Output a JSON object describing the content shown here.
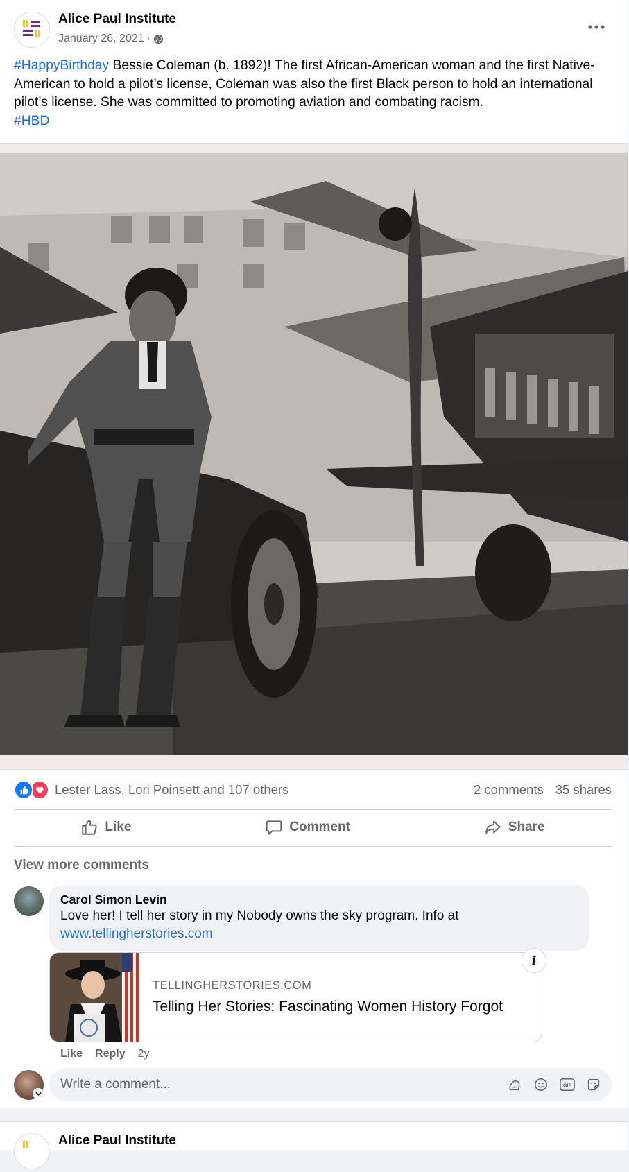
{
  "post": {
    "author": "Alice Paul Institute",
    "date": "January 26, 2021",
    "meta_separator": "·",
    "audience_icon": "globe-icon",
    "hashtag_1": "#HappyBirthday",
    "body": " Bessie Coleman (b. 1892)! The first African-American woman and the first Native-American to hold a pilot’s license, Coleman was also the first Black person to hold an international pilot’s license. She was committed to promoting aviation and combating racism.",
    "hashtag_2": "#HBD"
  },
  "reactions": {
    "names": "Lester Lass, Lori Poinsett and 107 others",
    "comments": "2 comments",
    "shares": "35 shares",
    "icons": [
      "like-icon",
      "love-icon"
    ]
  },
  "actions": {
    "like": "Like",
    "comment": "Comment",
    "share": "Share"
  },
  "comments": {
    "view_more": "View more comments",
    "items": [
      {
        "author": "Carol Simon Levin",
        "text": "Love her! I tell her story in my Nobody owns the sky program. Info at",
        "link": "www.tellingherstories.com",
        "preview": {
          "domain": "TELLINGHERSTORIES.COM",
          "title": "Telling Her Stories: Fascinating Women History Forgot"
        },
        "like": "Like",
        "reply": "Reply",
        "time": "2y"
      }
    ]
  },
  "composer": {
    "placeholder": "Write a comment..."
  },
  "next_post": {
    "author": "Alice Paul Institute"
  },
  "colors": {
    "brand_purple": "#6b2d7b",
    "brand_yellow": "#f2c230",
    "link_blue": "#216fdb",
    "like_blue": "#1877f2",
    "love_red": "#f33e58"
  }
}
